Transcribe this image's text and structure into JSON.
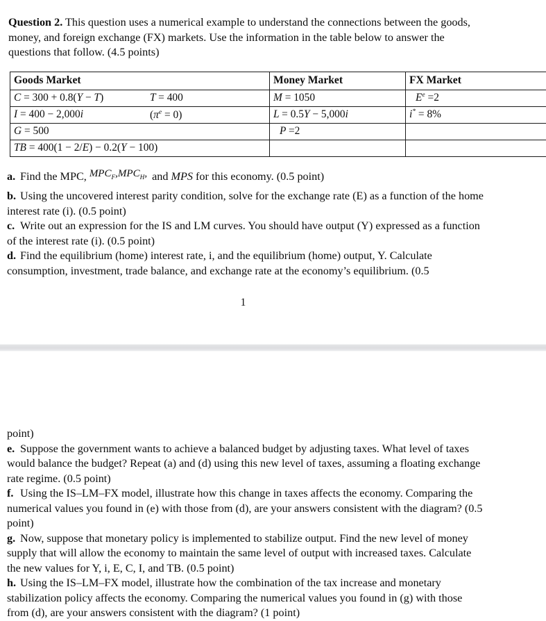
{
  "document": {
    "page_number": "1"
  },
  "intro": {
    "label": "Question 2.",
    "text": " This question uses a numerical example to understand the connections between the goods, money, and foreign exchange (FX) markets. Use the information in the table below to answer the questions that follow. (4.5 points)"
  },
  "table": {
    "headers": {
      "goods": "Goods Market",
      "money": "Money Market",
      "fx": "FX Market"
    },
    "goods_market": [
      {
        "equation": "C = 300 + 0.8(Y − T)",
        "note": "T = 400"
      },
      {
        "equation": "I = 400 − 2,000i",
        "note": "(πᵉ = 0)"
      },
      {
        "equation": "G = 500",
        "note": ""
      },
      {
        "equation": "TB = 400(1 − 2/E) − 0.2(Y − 100)",
        "note": ""
      }
    ],
    "money_market": [
      "M = 1050",
      "L = 0.5Y − 5,000i",
      "P = 2",
      ""
    ],
    "fx_market": [
      "Eᵉ = 2",
      "i* = 8%",
      "",
      ""
    ]
  },
  "questions_page1": [
    {
      "label": "a.",
      "pre": "Find the MPC,",
      "math": "MPC_F , MPC_H ,",
      "post": " and MPS for this economy. (0.5 point)"
    },
    {
      "label": "b.",
      "text": "Using the uncovered interest parity condition, solve for the exchange rate (E) as a function of the home interest rate (i). (0.5 point)"
    },
    {
      "label": "c.",
      "text": "Write out an expression for the IS and LM curves. You should have output (Y) expressed as a function of the interest rate (i). (0.5 point)"
    },
    {
      "label": "d.",
      "text": "Find the equilibrium (home) interest rate, i, and the equilibrium (home) output, Y. Calculate consumption, investment, trade balance, and exchange rate at the economy’s equilibrium. (0.5"
    }
  ],
  "questions_page2": [
    {
      "label": "",
      "text": "point)"
    },
    {
      "label": "e.",
      "text": "Suppose the government wants to achieve a balanced budget by adjusting taxes. What level of taxes would balance the budget? Repeat (a) and (d) using this new level of taxes, assuming a floating exchange rate regime. (0.5 point)"
    },
    {
      "label": "f.",
      "text": "Using the IS–LM–FX model, illustrate how this change in taxes affects the economy. Comparing the numerical values you found in (e) with those from (d), are your answers consistent with the diagram? (0.5 point)"
    },
    {
      "label": "g.",
      "text": "Now, suppose that monetary policy is implemented to stabilize output. Find the new level of money supply that will allow the economy to maintain the same level of output with increased taxes. Calculate the new values for Y, i, E, C, I, and TB. (0.5 point)"
    },
    {
      "label": "h.",
      "text": "Using the IS–LM–FX model, illustrate how the combination of the tax increase and monetary stabilization policy affects the economy. Comparing the numerical values you found in (g) with those from (d), are your answers consistent with the diagram? (1 point)"
    }
  ]
}
